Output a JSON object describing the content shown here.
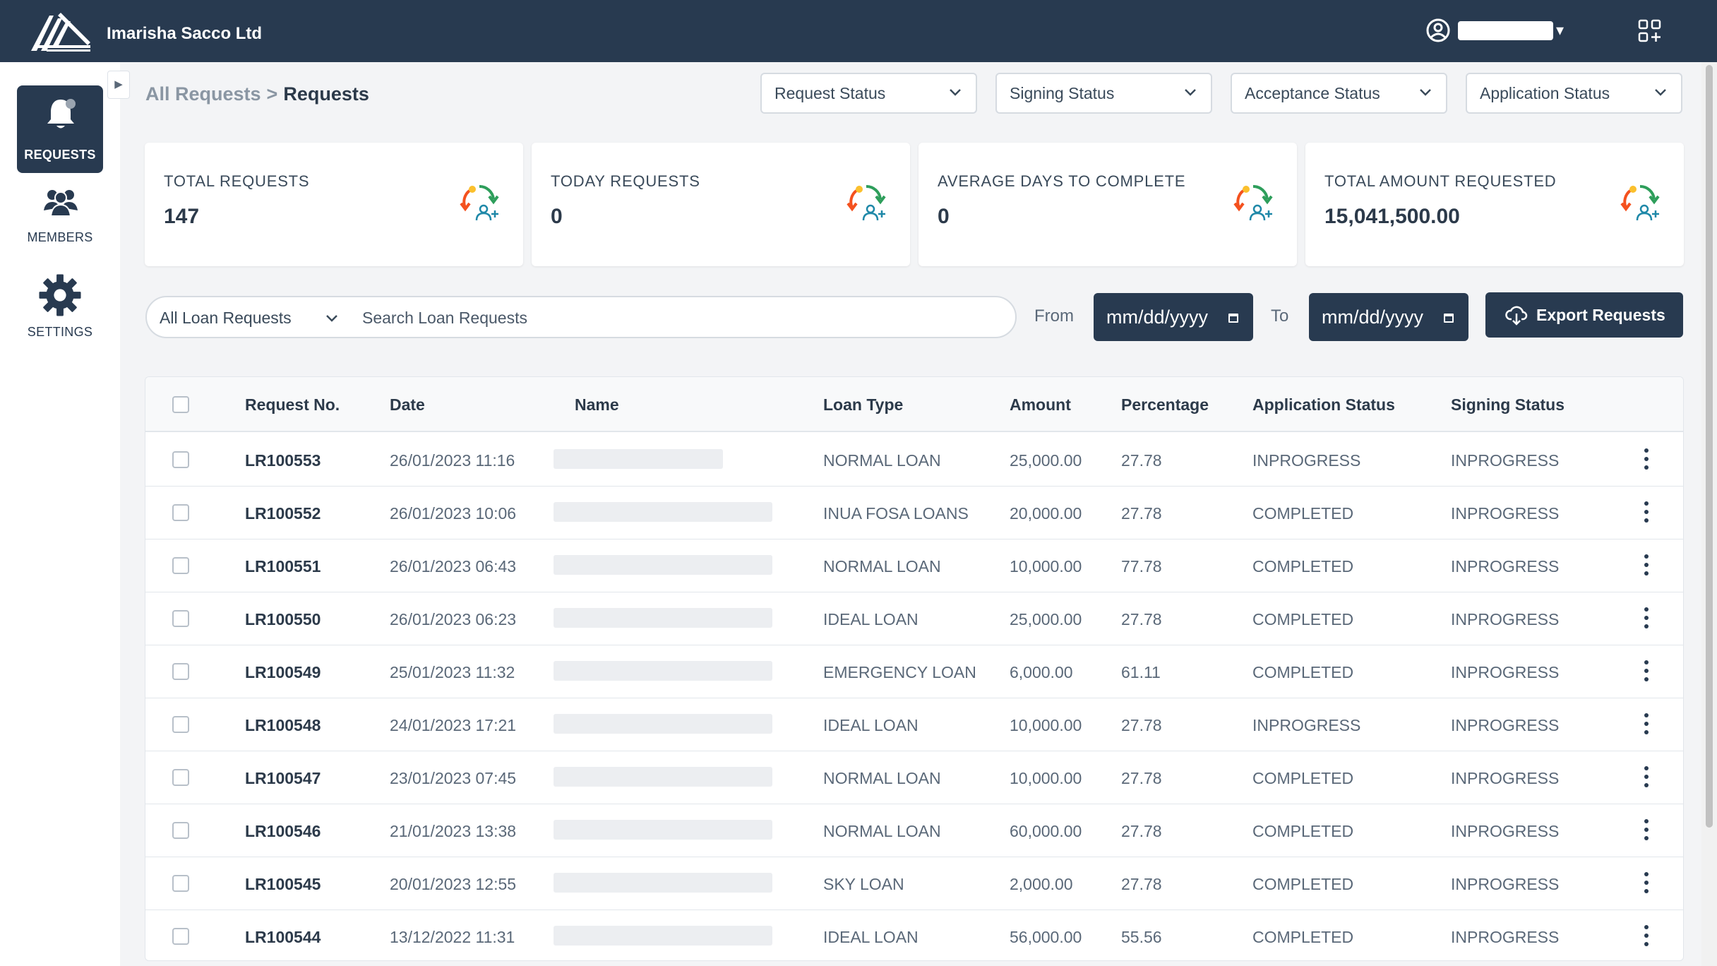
{
  "app": {
    "title": "Imarisha Sacco Ltd",
    "user_name": ""
  },
  "colors": {
    "primary": "#283a50",
    "icon_orange": "#f4511e",
    "icon_green": "#2e9e5b",
    "icon_yellow": "#fbc02d",
    "icon_teal": "#1e88a8"
  },
  "sidebar": {
    "items": [
      {
        "label": "REQUESTS",
        "icon": "bell-icon",
        "active": true
      },
      {
        "label": "MEMBERS",
        "icon": "members-icon",
        "active": false
      },
      {
        "label": "SETTINGS",
        "icon": "gear-icon",
        "active": false
      }
    ]
  },
  "breadcrumb": {
    "parent": "All Requests",
    "separator": ">",
    "current": "Requests"
  },
  "filters": [
    {
      "label": "Request Status"
    },
    {
      "label": "Signing Status"
    },
    {
      "label": "Acceptance Status"
    },
    {
      "label": "Application Status"
    }
  ],
  "stats": [
    {
      "label": "TOTAL REQUESTS",
      "value": "147"
    },
    {
      "label": "TODAY REQUESTS",
      "value": "0"
    },
    {
      "label": "AVERAGE DAYS TO COMPLETE",
      "value": "0"
    },
    {
      "label": "TOTAL AMOUNT REQUESTED",
      "value": "15,041,500.00"
    }
  ],
  "search": {
    "scope": "All Loan Requests",
    "placeholder": "Search Loan Requests",
    "value": ""
  },
  "date_range": {
    "from_label": "From",
    "to_label": "To",
    "from_value": "mm/dd/yyyy",
    "to_value": "mm/dd/yyyy"
  },
  "export": {
    "label": "Export Requests"
  },
  "table": {
    "columns": [
      "Request No.",
      "Date",
      "Name",
      "Loan Type",
      "Amount",
      "Percentage",
      "Application Status",
      "Signing Status"
    ],
    "rows": [
      {
        "request_no": "LR100553",
        "date": "26/01/2023 11:16",
        "name": "",
        "loan_type": "NORMAL LOAN",
        "amount": "25,000.00",
        "percentage": "27.78",
        "application_status": "INPROGRESS",
        "signing_status": "INPROGRESS"
      },
      {
        "request_no": "LR100552",
        "date": "26/01/2023 10:06",
        "name": "",
        "loan_type": "INUA FOSA LOANS",
        "amount": "20,000.00",
        "percentage": "27.78",
        "application_status": "COMPLETED",
        "signing_status": "INPROGRESS"
      },
      {
        "request_no": "LR100551",
        "date": "26/01/2023 06:43",
        "name": "",
        "loan_type": "NORMAL LOAN",
        "amount": "10,000.00",
        "percentage": "77.78",
        "application_status": "COMPLETED",
        "signing_status": "INPROGRESS"
      },
      {
        "request_no": "LR100550",
        "date": "26/01/2023 06:23",
        "name": "",
        "loan_type": "IDEAL LOAN",
        "amount": "25,000.00",
        "percentage": "27.78",
        "application_status": "COMPLETED",
        "signing_status": "INPROGRESS"
      },
      {
        "request_no": "LR100549",
        "date": "25/01/2023 11:32",
        "name": "",
        "loan_type": "EMERGENCY LOAN",
        "amount": "6,000.00",
        "percentage": "61.11",
        "application_status": "COMPLETED",
        "signing_status": "INPROGRESS"
      },
      {
        "request_no": "LR100548",
        "date": "24/01/2023 17:21",
        "name": "",
        "loan_type": "IDEAL LOAN",
        "amount": "10,000.00",
        "percentage": "27.78",
        "application_status": "INPROGRESS",
        "signing_status": "INPROGRESS"
      },
      {
        "request_no": "LR100547",
        "date": "23/01/2023 07:45",
        "name": "",
        "loan_type": "NORMAL LOAN",
        "amount": "10,000.00",
        "percentage": "27.78",
        "application_status": "COMPLETED",
        "signing_status": "INPROGRESS"
      },
      {
        "request_no": "LR100546",
        "date": "21/01/2023 13:38",
        "name": "",
        "loan_type": "NORMAL LOAN",
        "amount": "60,000.00",
        "percentage": "27.78",
        "application_status": "COMPLETED",
        "signing_status": "INPROGRESS"
      },
      {
        "request_no": "LR100545",
        "date": "20/01/2023 12:55",
        "name": "",
        "loan_type": "SKY LOAN",
        "amount": "2,000.00",
        "percentage": "27.78",
        "application_status": "COMPLETED",
        "signing_status": "INPROGRESS"
      },
      {
        "request_no": "LR100544",
        "date": "13/12/2022 11:31",
        "name": "",
        "loan_type": "IDEAL LOAN",
        "amount": "56,000.00",
        "percentage": "55.56",
        "application_status": "COMPLETED",
        "signing_status": "INPROGRESS"
      }
    ]
  }
}
